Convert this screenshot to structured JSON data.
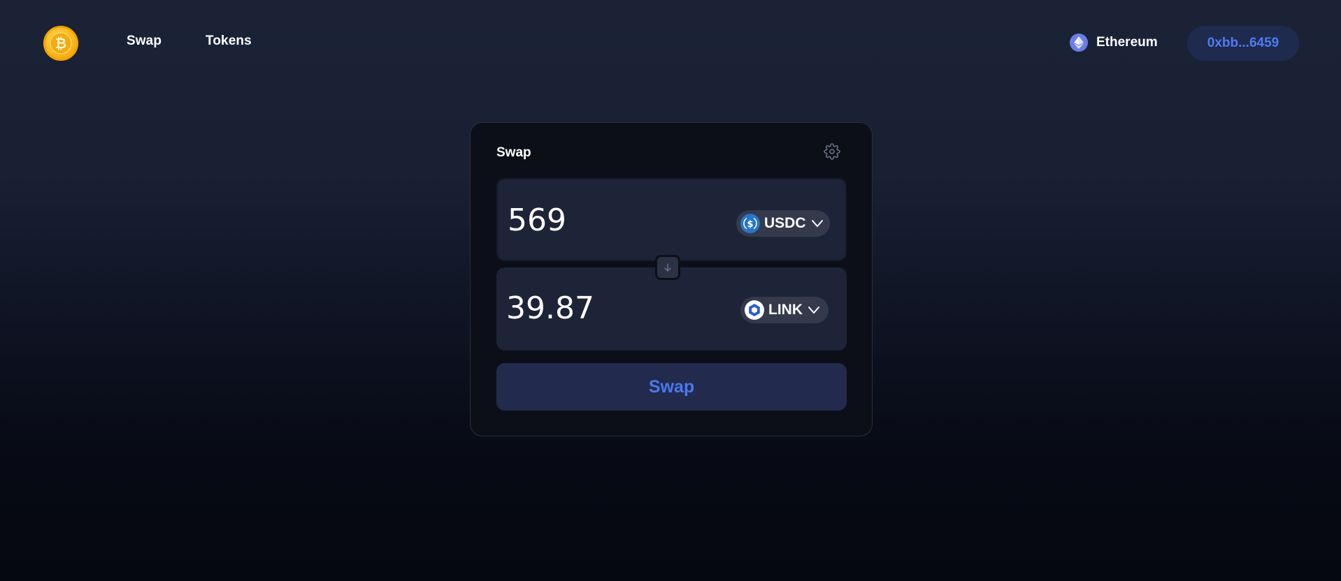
{
  "header": {
    "logo_icon": "bitcoin-logo-icon",
    "nav": [
      {
        "label": "Swap"
      },
      {
        "label": "Tokens"
      }
    ],
    "network": {
      "label": "Ethereum",
      "icon": "ethereum-icon"
    },
    "wallet_address": "0xbb...6459"
  },
  "swap_card": {
    "title": "Swap",
    "settings_icon": "gear-icon",
    "from": {
      "amount": "569",
      "token": "USDC",
      "token_icon": "usdc-icon"
    },
    "to": {
      "amount": "39.87",
      "token": "LINK",
      "token_icon": "chainlink-icon"
    },
    "flip_icon": "arrow-down-icon",
    "swap_button_label": "Swap"
  },
  "colors": {
    "accent": "#4f7cf2",
    "card_bg": "#0d0f18",
    "input_bg": "#1e2437",
    "button_bg": "#222b4e"
  }
}
